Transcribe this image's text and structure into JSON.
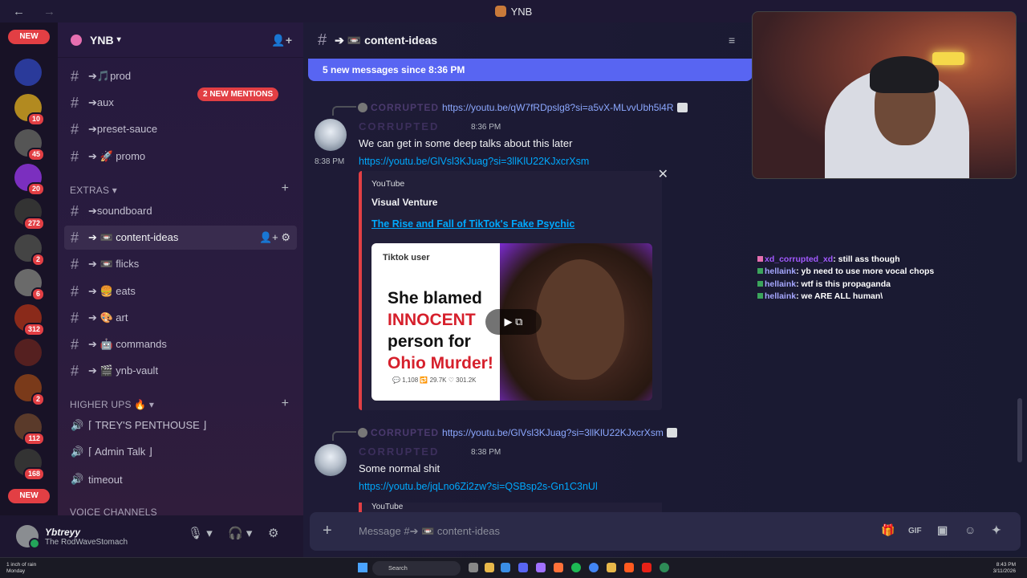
{
  "window": {
    "title": "YNB",
    "back": "←",
    "forward": "→"
  },
  "servers": {
    "new_top": "NEW",
    "new_bottom": "NEW",
    "badges": [
      "10",
      "45",
      "20",
      "272",
      "2",
      "6",
      "312",
      "2",
      "112",
      "168"
    ]
  },
  "guild": {
    "name": "YNB"
  },
  "mention_pill": "2 NEW MENTIONS",
  "channels": {
    "items": [
      {
        "label": "➔🎵prod"
      },
      {
        "label": "➔aux"
      },
      {
        "label": "➔preset-sauce"
      },
      {
        "label": "➔ 🚀 promo"
      },
      {
        "label": "➔soundboard"
      },
      {
        "label": "➔ 📼 content-ideas"
      },
      {
        "label": "➔ 📼 flicks"
      },
      {
        "label": "➔ 🍔 eats"
      },
      {
        "label": "➔ 🎨 art"
      },
      {
        "label": "➔ 🤖 commands"
      },
      {
        "label": "➔ 🎬 ynb-vault"
      }
    ],
    "categories": {
      "extras": "EXTRAS",
      "higher_ups": "HIGHER UPS 🔥",
      "voice": "VOICE CHANNELS"
    },
    "voice": [
      {
        "label": "⌈ TREY'S PENTHOUSE ⌋"
      },
      {
        "label": "⌈ Admin Talk ⌋"
      },
      {
        "label": "timeout"
      }
    ]
  },
  "user": {
    "name": "Ybtreyy",
    "status": "The RodWaveStomach"
  },
  "header": {
    "channel": "➔ 📼 content-ideas"
  },
  "new_messages_bar": "5 new messages since 8:36 PM",
  "messages": [
    {
      "reply_name": "CORRUPTED",
      "reply_link": "https://youtu.be/qW7fRDpslg8?si=a5vX-MLvvUbh5l4R",
      "author": "CORRUPTED",
      "time": "8:36 PM",
      "text": "We can get in some deep talks about this later",
      "side_time": "8:38 PM",
      "link": "https://youtu.be/GlVsl3KJuag?si=3llKlU22KJxcrXsm",
      "embed": {
        "provider": "YouTube",
        "author": "Visual Venture",
        "title": "The Rise and Fall of TikTok's Fake Psychic",
        "thumb_user": "Tiktok user",
        "thumb_line1": "She blamed",
        "thumb_line2": "INNOCENT",
        "thumb_line3": "person for",
        "thumb_line4": "Ohio Murder!",
        "thumb_stats": "💬 1,108   🔁 29.7K   ♡ 301.2K"
      }
    },
    {
      "reply_name": "CORRUPTED",
      "reply_link": "https://youtu.be/GlVsl3KJuag?si=3llKlU22KJxcrXsm",
      "author": "CORRUPTED",
      "time": "8:38 PM",
      "text": "Some normal shit",
      "link": "https://youtu.be/jqLno6Zi2zw?si=QSBsp2s-Gn1C3nUl",
      "embed_provider": "YouTube"
    }
  ],
  "composer": {
    "placeholder": "Message #➔ 📼 content-ideas"
  },
  "stream_chat": [
    {
      "user": "xd_corrupted_xd",
      "text": ": still ass though"
    },
    {
      "user": "hellaink",
      "text": ": yb need to use more vocal chops"
    },
    {
      "user": "hellaink",
      "text": ": wtf is this propaganda"
    },
    {
      "user": "hellaink",
      "text": ": we ARE ALL human\\"
    }
  ],
  "taskbar": {
    "weather_line1": "1 inch of rain",
    "weather_line2": "Monday",
    "search": "Search",
    "time": "8:43 PM",
    "date": "3/11/2026"
  }
}
